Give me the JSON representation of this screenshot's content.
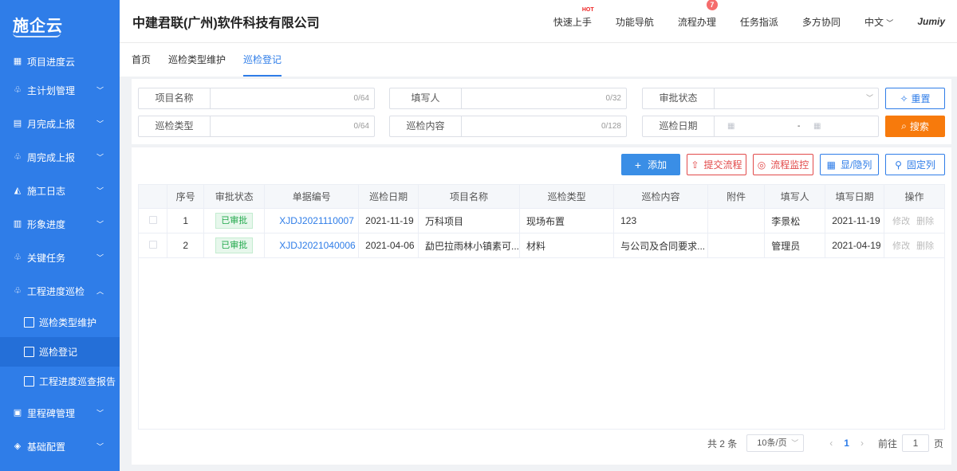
{
  "app": {
    "logo": "施企云",
    "company": "中建君联(广州)软件科技有限公司"
  },
  "header": {
    "nav": [
      {
        "label": "快速上手",
        "flag": "HOT"
      },
      {
        "label": "功能导航"
      },
      {
        "label": "流程办理",
        "badge": "7"
      },
      {
        "label": "任务指派"
      },
      {
        "label": "多方协同"
      },
      {
        "label": "中文"
      }
    ],
    "brand": "Jumiy"
  },
  "sidebar": {
    "items": [
      {
        "label": "项目进度云",
        "icon": "grid-icon"
      },
      {
        "label": "主计划管理",
        "icon": "org-icon"
      },
      {
        "label": "月完成上报",
        "icon": "doc-icon"
      },
      {
        "label": "周完成上报",
        "icon": "org-icon"
      },
      {
        "label": "施工日志",
        "icon": "helmet-icon"
      },
      {
        "label": "形象进度",
        "icon": "building-icon"
      },
      {
        "label": "关键任务",
        "icon": "org-icon"
      },
      {
        "label": "工程进度巡检",
        "icon": "org-icon"
      }
    ],
    "sub_items": [
      {
        "label": "巡检类型维护"
      },
      {
        "label": "巡检登记"
      },
      {
        "label": "工程进度巡查报告"
      }
    ],
    "bottom_items": [
      {
        "label": "里程碑管理",
        "icon": "milestone-icon"
      },
      {
        "label": "基础配置",
        "icon": "layers-icon"
      }
    ]
  },
  "tabs": [
    "首页",
    "巡检类型维护",
    "巡检登记"
  ],
  "filters": {
    "project_name": {
      "label": "项目名称",
      "count": "0/64"
    },
    "filler": {
      "label": "填写人",
      "count": "0/32"
    },
    "approval_status": {
      "label": "审批状态"
    },
    "inspect_type": {
      "label": "巡检类型",
      "count": "0/64"
    },
    "inspect_content": {
      "label": "巡检内容",
      "count": "0/128"
    },
    "inspect_date": {
      "label": "巡检日期",
      "sep": "-"
    },
    "reset": "重置",
    "search": "搜索"
  },
  "toolbar": {
    "add": "添加",
    "submit": "提交流程",
    "monitor": "流程监控",
    "toggle_cols": "显/隐列",
    "fix_cols": "固定列"
  },
  "table": {
    "headers": [
      "序号",
      "审批状态",
      "单据编号",
      "巡检日期",
      "项目名称",
      "巡检类型",
      "巡检内容",
      "附件",
      "填写人",
      "填写日期",
      "操作"
    ],
    "rows": [
      {
        "no": "1",
        "status": "已审批",
        "code": "XJDJ2021110007",
        "date": "2021-11-19",
        "project": "万科项目",
        "type": "现场布置",
        "content": "123",
        "attach": "",
        "filler": "李景松",
        "fill_date": "2021-11-19",
        "edit": "修改",
        "del": "删除"
      },
      {
        "no": "2",
        "status": "已审批",
        "code": "XJDJ2021040006",
        "date": "2021-04-06",
        "project": "勐巴拉雨林小镇素可...",
        "type": "材料",
        "content": "与公司及合同要求...",
        "attach": "",
        "filler": "管理员",
        "fill_date": "2021-04-19",
        "edit": "修改",
        "del": "删除"
      }
    ]
  },
  "pager": {
    "total": "共 2 条",
    "size": "10条/页",
    "page": "1",
    "goto": "前往",
    "goto_val": "1",
    "unit": "页"
  },
  "colors": {
    "primary": "#2f7de8",
    "orange": "#f77a0c",
    "danger": "#e24a4a",
    "success": "#21a84b"
  }
}
